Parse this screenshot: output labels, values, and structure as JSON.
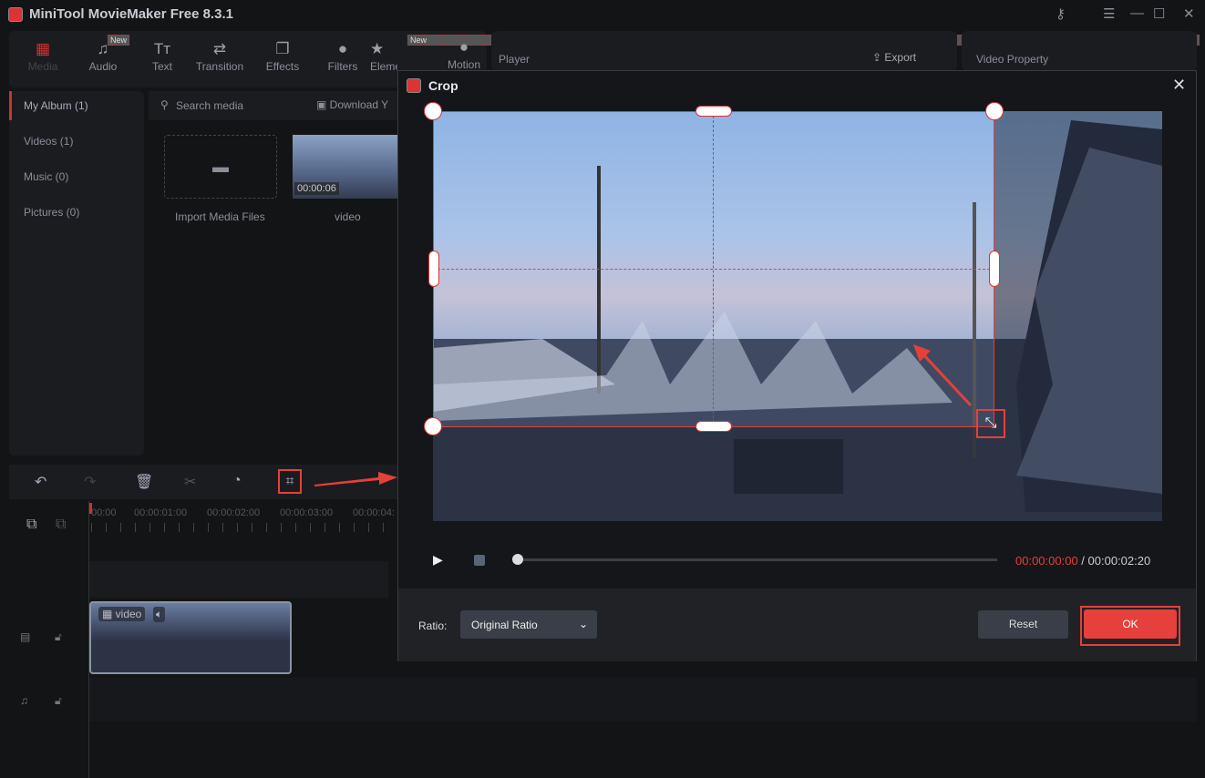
{
  "app": {
    "title": "MiniTool MovieMaker Free 8.3.1"
  },
  "toolbar": {
    "items": [
      {
        "label": "Media",
        "icon": "media-icon"
      },
      {
        "label": "Audio",
        "icon": "music-note-icon",
        "badge": "New"
      },
      {
        "label": "Text",
        "icon": "text-icon"
      },
      {
        "label": "Transition",
        "icon": "transition-icon"
      },
      {
        "label": "Effects",
        "icon": "effects-icon"
      },
      {
        "label": "Filters",
        "icon": "filters-icon"
      },
      {
        "label": "Elements",
        "icon": "elements-icon",
        "badge": "New"
      },
      {
        "label": "Motion",
        "icon": "motion-icon"
      }
    ]
  },
  "player": {
    "title": "Player",
    "export_label": "Export"
  },
  "property": {
    "title": "Video Property"
  },
  "sidebar": {
    "items": [
      "My Album (1)",
      "Videos (1)",
      "Music (0)",
      "Pictures (0)"
    ]
  },
  "media": {
    "search_placeholder": "Search media",
    "download_label": "Download Y",
    "import_label": "Import Media Files",
    "clip_name": "video",
    "clip_duration": "00:00:06"
  },
  "timeline": {
    "ticks": [
      "00:00",
      "00:00:01:00",
      "00:00:02:00",
      "00:00:03:00",
      "00:00:04:"
    ],
    "clip_label": "video"
  },
  "crop": {
    "title": "Crop",
    "current_time": "00:00:00:00",
    "separator": " / ",
    "total_time": "00:00:02:20",
    "progress": 0,
    "ratio_label": "Ratio:",
    "ratio_value": "Original Ratio",
    "reset_label": "Reset",
    "ok_label": "OK"
  },
  "colors": {
    "accent": "#e5403b",
    "bg": "#131416"
  }
}
